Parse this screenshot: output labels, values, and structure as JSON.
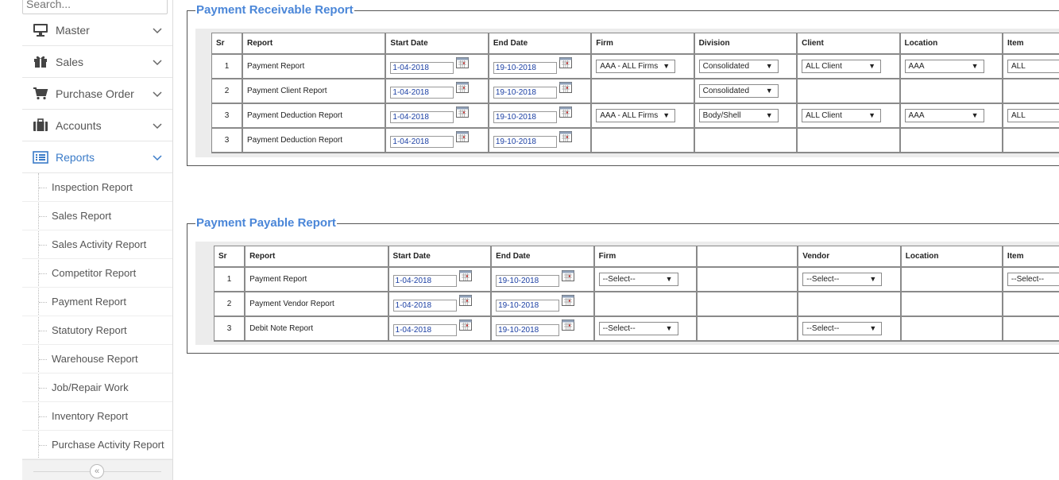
{
  "sidebar": {
    "search_placeholder": "Search...",
    "menu": [
      {
        "label": "Master"
      },
      {
        "label": "Sales"
      },
      {
        "label": "Purchase Order"
      },
      {
        "label": "Accounts"
      },
      {
        "label": "Reports"
      }
    ],
    "submenu": [
      "Inspection Report",
      "Sales Report",
      "Sales Activity Report",
      "Competitor Report",
      "Payment Report",
      "Statutory Report",
      "Warehouse Report",
      "Job/Repair Work",
      "Inventory Report",
      "Purchase Activity Report"
    ],
    "collapse_icon": "«"
  },
  "receivable": {
    "title": "Payment Receivable Report",
    "headers": [
      "Sr",
      "Report",
      "Start Date",
      "End Date",
      "Firm",
      "Division",
      "Client",
      "Location",
      "Item"
    ],
    "rows": [
      {
        "sr": "1",
        "report": "Payment Report",
        "start": "1-04-2018",
        "end": "19-10-2018",
        "firm": "AAA - ALL Firms",
        "division": "Consolidated",
        "client": "ALL Client",
        "location": "AAA",
        "item": "ALL"
      },
      {
        "sr": "2",
        "report": "Payment Client Report",
        "start": "1-04-2018",
        "end": "19-10-2018",
        "firm": "",
        "division": "Consolidated",
        "client": "",
        "location": "",
        "item": ""
      },
      {
        "sr": "3",
        "report": "Payment Deduction Report",
        "start": "1-04-2018",
        "end": "19-10-2018",
        "firm": "AAA - ALL Firms",
        "division": "Body/Shell",
        "client": "ALL Client",
        "location": "AAA",
        "item": "ALL"
      },
      {
        "sr": "3",
        "report": "Payment Deduction Report",
        "start": "1-04-2018",
        "end": "19-10-2018",
        "firm": "",
        "division": "",
        "client": "",
        "location": "",
        "item": ""
      }
    ]
  },
  "payable": {
    "title": "Payment Payable Report",
    "headers": [
      "Sr",
      "Report",
      "Start Date",
      "End Date",
      "Firm",
      "",
      "Vendor",
      "Location",
      "Item"
    ],
    "rows": [
      {
        "sr": "1",
        "report": "Payment Report",
        "start": "1-04-2018",
        "end": "19-10-2018",
        "firm": "--Select--",
        "vendor": "--Select--",
        "item": "--Select--"
      },
      {
        "sr": "2",
        "report": "Payment Vendor Report",
        "start": "1-04-2018",
        "end": "19-10-2018",
        "firm": "",
        "vendor": "",
        "item": ""
      },
      {
        "sr": "3",
        "report": "Debit Note Report",
        "start": "1-04-2018",
        "end": "19-10-2018",
        "firm": "--Select--",
        "vendor": "--Select--",
        "item": ""
      }
    ]
  }
}
